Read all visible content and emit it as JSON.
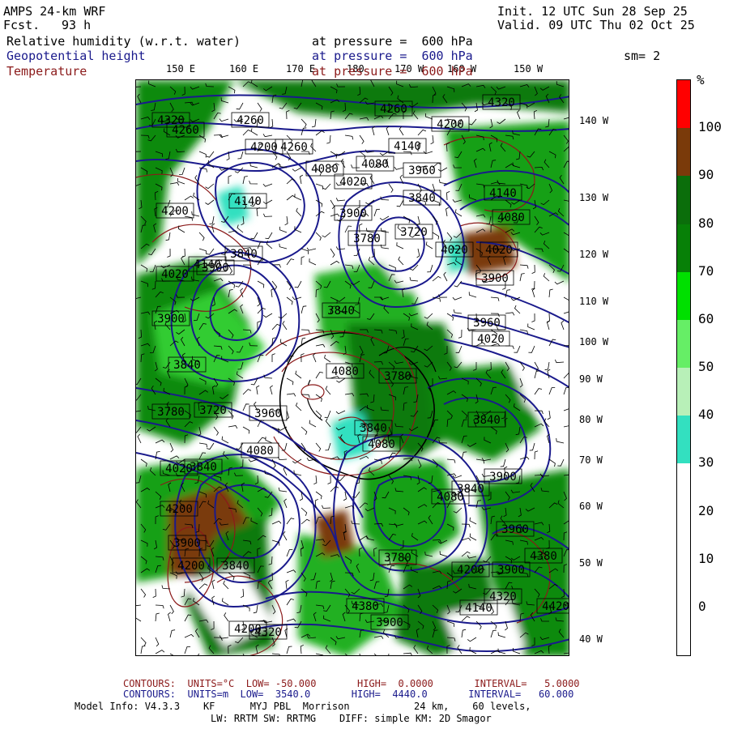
{
  "header": {
    "model": "AMPS 24-km WRF",
    "fcst_label": "Fcst.",
    "fcst_hours": "93 h",
    "init": "Init. 12 UTC Sun 28 Sep 25",
    "valid": "Valid. 09 UTC Thu 02 Oct 25",
    "fields": [
      {
        "name": "Relative humidity (w.r.t. water)",
        "level": "at pressure =  600 hPa",
        "color": "#000000"
      },
      {
        "name": "Geopotential height",
        "level": "at pressure =  600 hPa",
        "color": "#1a1a8c"
      },
      {
        "name": "Temperature",
        "level": "at pressure =  600 hPa",
        "color": "#8b1a1a"
      }
    ],
    "smoothing": "sm= 2"
  },
  "map": {
    "top_labels": [
      "150 E",
      "160 E",
      "170 E",
      "180",
      "170 W",
      "160 W",
      "150 W"
    ],
    "right_labels": [
      "140 W",
      "130 W",
      "120 W",
      "110 W",
      "100 W",
      "90 W",
      "80 W",
      "70 W",
      "60 W",
      "50 W",
      "40 W"
    ],
    "height_labels": [
      "4320",
      "4260",
      "4260",
      "4260",
      "4200",
      "4260",
      "4140",
      "4200",
      "4080",
      "4080",
      "4320",
      "4020",
      "3960",
      "4140",
      "4200",
      "4140",
      "4020",
      "3900",
      "3840",
      "4080",
      "3720",
      "3780",
      "4020",
      "4020",
      "3900",
      "3840",
      "3900",
      "4140",
      "3840",
      "3900",
      "3960",
      "4020",
      "3840",
      "4080",
      "3780",
      "3840",
      "3780",
      "3720",
      "4080",
      "3840",
      "4020",
      "3840",
      "3960",
      "4080",
      "3840",
      "3900",
      "4200",
      "3900",
      "3900",
      "3780",
      "4200",
      "3840",
      "4200",
      "3900",
      "4380",
      "3960",
      "4080",
      "4140",
      "4320",
      "4420",
      "4320",
      "4200",
      "4380"
    ],
    "colors": {
      "height_contour": "#1a1a8c",
      "temp_contour": "#8b1a1a",
      "land": "#6b3a1a"
    }
  },
  "colorbar": {
    "unit": "%",
    "ticks": [
      "100",
      "90",
      "80",
      "70",
      "60",
      "50",
      "40",
      "30",
      "20",
      "10",
      "0"
    ],
    "colors": [
      "#ff0000",
      "#7a3a0a",
      "#0b6e0b",
      "#078007",
      "#00e000",
      "#66ee66",
      "#b8f0b8",
      "#33e0c0",
      "#ffffff",
      "#ffffff",
      "#ffffff",
      "#ffffff"
    ]
  },
  "footer": {
    "temp_line": "CONTOURS:  UNITS=°C  LOW= -50.000       HIGH=  0.0000       INTERVAL=   5.0000",
    "height_line": "CONTOURS:  UNITS=m  LOW=  3540.0       HIGH=  4440.0       INTERVAL=   60.000",
    "model_info": "Model Info: V4.3.3    KF      MYJ PBL  Morrison           24 km,    60 levels,",
    "model_info2": "LW: RRTM SW: RRTMG    DIFF: simple KM: 2D Smagor"
  }
}
